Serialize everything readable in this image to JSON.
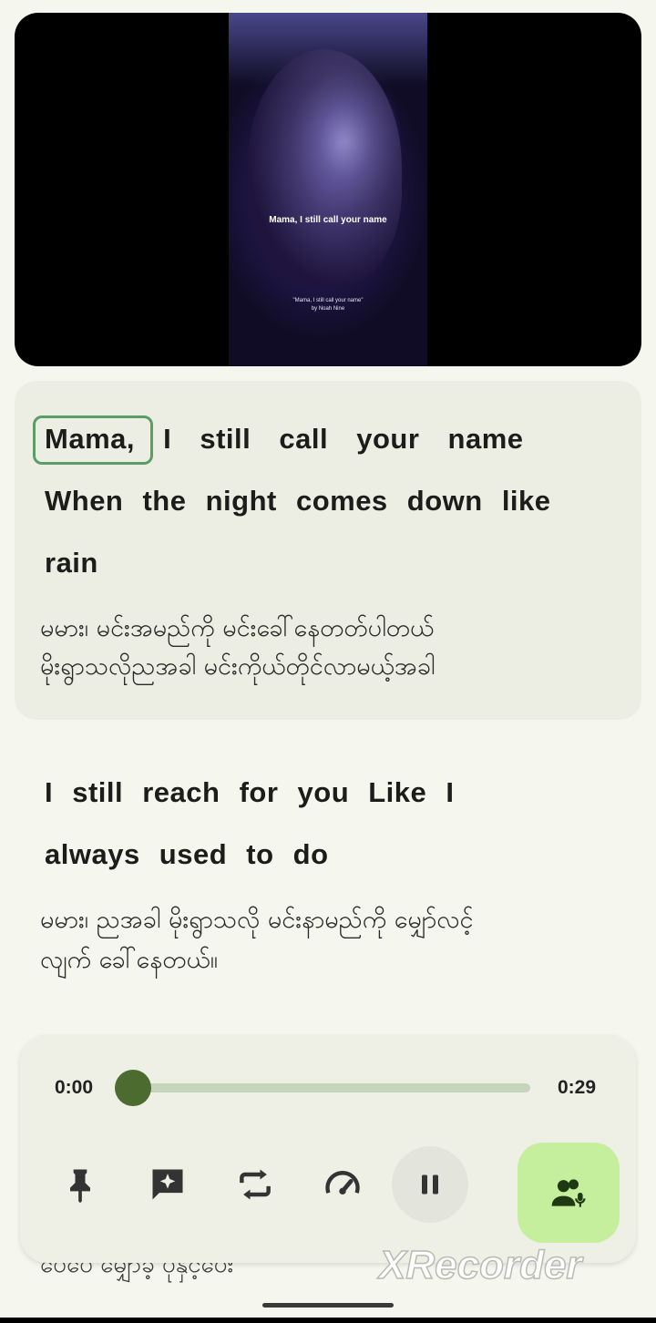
{
  "video": {
    "caption": "Mama, I still call your name",
    "credit_line1": "\"Mama, I still call your name\"",
    "credit_line2": "by Noah Nine"
  },
  "active_lyric": {
    "words": [
      "Mama,",
      "I",
      "still",
      "call",
      "your",
      "name"
    ],
    "line2": "When the night comes down like",
    "line3": "rain",
    "translation_line1": "မမား၊ မင်းအမည်ကို မင်းခေါ်နေတတ်ပါတယ်",
    "translation_line2": "မိုးရွာသလိုညအခါ မင်းကိုယ်တိုင်လာမယ့်အခါ"
  },
  "next_lyric": {
    "line1": "I still reach for you Like I",
    "line2": "always used to do",
    "translation_line1": "မမား၊ ညအခါ မိုးရွာသလို မင်းနာမည်ကို မျှော်လင့်",
    "translation_line2": "လျက် ခေါ်နေတယ်။"
  },
  "peek_text": "ပေပေ မျှော်ခဲ့ ပုံနှင့်ပေး",
  "player": {
    "current_time": "0:00",
    "duration": "0:29",
    "progress": 0.0,
    "buttons": {
      "pin": "pin-icon",
      "ai": "ai-sparkle-icon",
      "repeat": "repeat-icon",
      "speed": "speed-icon",
      "pause": "pause-icon",
      "singer": "singer-mode-icon"
    }
  },
  "watermark": "XRecorder",
  "colors": {
    "background": "#f5f7ee",
    "active_card": "#eceee4",
    "highlight_border": "#5a9e63",
    "accent_green": "#4c6b2f",
    "singer_button": "#c5ef9d"
  }
}
